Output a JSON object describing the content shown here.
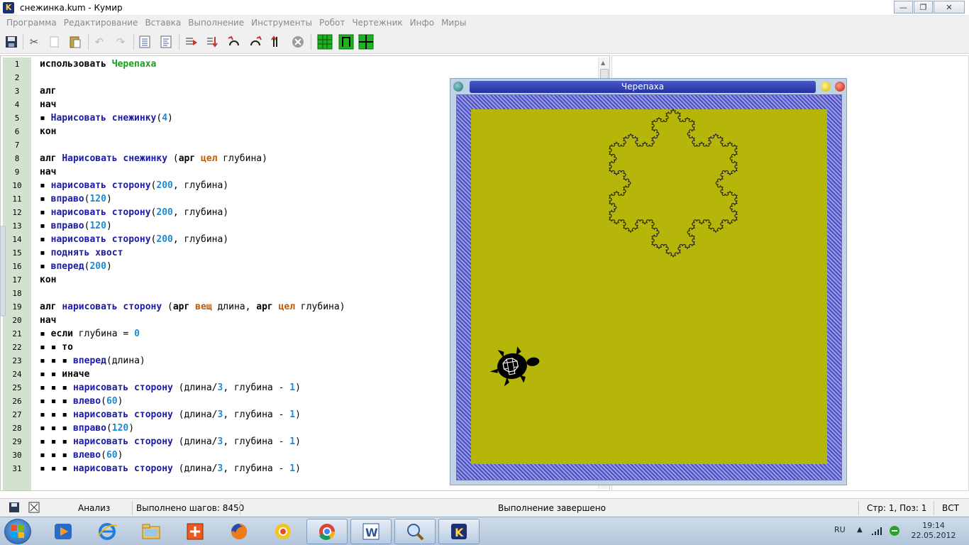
{
  "window": {
    "title": "снежинка.kum - Кумир",
    "app_icon_letter": "K",
    "buttons": [
      "minimize",
      "maximize",
      "close"
    ]
  },
  "menu": [
    "Программа",
    "Редактирование",
    "Вставка",
    "Выполнение",
    "Инструменты",
    "Робот",
    "Чертежник",
    "Инфо",
    "Миры"
  ],
  "toolbar": {
    "icons": [
      "save-icon",
      "cut-icon",
      "copy-icon",
      "paste-icon",
      "undo-icon",
      "redo-icon",
      "indent-icon",
      "unindent-icon",
      "run-icon",
      "step-icon",
      "step-into-icon",
      "step-out-icon",
      "to-end-icon",
      "stop-icon",
      "grid-icon",
      "robot-window-icon",
      "drawer-window-icon"
    ]
  },
  "editor": {
    "lines": [
      {
        "n": "1",
        "tokens": [
          [
            "k",
            "использовать "
          ],
          [
            "g",
            "Черепаха"
          ]
        ]
      },
      {
        "n": "2",
        "tokens": []
      },
      {
        "n": "3",
        "tokens": [
          [
            "k",
            "алг"
          ]
        ]
      },
      {
        "n": "4",
        "tokens": [
          [
            "k",
            "нач"
          ]
        ]
      },
      {
        "n": "5",
        "tokens": [
          [
            "k",
            "▪ "
          ],
          [
            "n",
            "Нарисовать снежинку"
          ],
          [
            "p",
            "("
          ],
          [
            "num",
            "4"
          ],
          [
            "p",
            ")"
          ]
        ]
      },
      {
        "n": "6",
        "tokens": [
          [
            "k",
            "кон"
          ]
        ]
      },
      {
        "n": "7",
        "tokens": []
      },
      {
        "n": "8",
        "tokens": [
          [
            "k",
            "алг "
          ],
          [
            "n",
            "Нарисовать снежинку"
          ],
          [
            "p",
            " ("
          ],
          [
            "k",
            "арг "
          ],
          [
            "t",
            "цел"
          ],
          [
            "p",
            " глубина)"
          ]
        ]
      },
      {
        "n": "9",
        "tokens": [
          [
            "k",
            "нач"
          ]
        ]
      },
      {
        "n": "10",
        "tokens": [
          [
            "k",
            "▪ "
          ],
          [
            "n",
            "нарисовать сторону"
          ],
          [
            "p",
            "("
          ],
          [
            "num",
            "200"
          ],
          [
            "p",
            ", глубина)"
          ]
        ]
      },
      {
        "n": "11",
        "tokens": [
          [
            "k",
            "▪ "
          ],
          [
            "n",
            "вправо"
          ],
          [
            "p",
            "("
          ],
          [
            "num",
            "120"
          ],
          [
            "p",
            ")"
          ]
        ]
      },
      {
        "n": "12",
        "tokens": [
          [
            "k",
            "▪ "
          ],
          [
            "n",
            "нарисовать сторону"
          ],
          [
            "p",
            "("
          ],
          [
            "num",
            "200"
          ],
          [
            "p",
            ", глубина)"
          ]
        ]
      },
      {
        "n": "13",
        "tokens": [
          [
            "k",
            "▪ "
          ],
          [
            "n",
            "вправо"
          ],
          [
            "p",
            "("
          ],
          [
            "num",
            "120"
          ],
          [
            "p",
            ")"
          ]
        ]
      },
      {
        "n": "14",
        "tokens": [
          [
            "k",
            "▪ "
          ],
          [
            "n",
            "нарисовать сторону"
          ],
          [
            "p",
            "("
          ],
          [
            "num",
            "200"
          ],
          [
            "p",
            ", глубина)"
          ]
        ]
      },
      {
        "n": "15",
        "tokens": [
          [
            "k",
            "▪ "
          ],
          [
            "n",
            "поднять хвост"
          ]
        ]
      },
      {
        "n": "16",
        "tokens": [
          [
            "k",
            "▪ "
          ],
          [
            "n",
            "вперед"
          ],
          [
            "p",
            "("
          ],
          [
            "num",
            "200"
          ],
          [
            "p",
            ")"
          ]
        ]
      },
      {
        "n": "17",
        "tokens": [
          [
            "k",
            "кон"
          ]
        ]
      },
      {
        "n": "18",
        "tokens": []
      },
      {
        "n": "19",
        "tokens": [
          [
            "k",
            "алг "
          ],
          [
            "n",
            "нарисовать сторону"
          ],
          [
            "p",
            " ("
          ],
          [
            "k",
            "арг "
          ],
          [
            "t",
            "вещ"
          ],
          [
            "p",
            " длина, "
          ],
          [
            "k",
            "арг "
          ],
          [
            "t",
            "цел"
          ],
          [
            "p",
            " глубина)"
          ]
        ]
      },
      {
        "n": "20",
        "tokens": [
          [
            "k",
            "нач"
          ]
        ]
      },
      {
        "n": "21",
        "tokens": [
          [
            "k",
            "▪ если"
          ],
          [
            "p",
            " глубина = "
          ],
          [
            "num",
            "0"
          ]
        ]
      },
      {
        "n": "22",
        "tokens": [
          [
            "k",
            "▪ ▪ то"
          ]
        ]
      },
      {
        "n": "23",
        "tokens": [
          [
            "k",
            "▪ ▪ ▪ "
          ],
          [
            "n",
            "вперед"
          ],
          [
            "p",
            "(длина)"
          ]
        ]
      },
      {
        "n": "24",
        "tokens": [
          [
            "k",
            "▪ ▪ иначе"
          ]
        ]
      },
      {
        "n": "25",
        "tokens": [
          [
            "k",
            "▪ ▪ ▪ "
          ],
          [
            "n",
            "нарисовать сторону"
          ],
          [
            "p",
            " (длина/"
          ],
          [
            "num",
            "3"
          ],
          [
            "p",
            ", глубина - "
          ],
          [
            "num",
            "1"
          ],
          [
            "p",
            ")"
          ]
        ]
      },
      {
        "n": "26",
        "tokens": [
          [
            "k",
            "▪ ▪ ▪ "
          ],
          [
            "n",
            "влево"
          ],
          [
            "p",
            "("
          ],
          [
            "num",
            "60"
          ],
          [
            "p",
            ")"
          ]
        ]
      },
      {
        "n": "27",
        "tokens": [
          [
            "k",
            "▪ ▪ ▪ "
          ],
          [
            "n",
            "нарисовать сторону"
          ],
          [
            "p",
            " (длина/"
          ],
          [
            "num",
            "3"
          ],
          [
            "p",
            ", глубина - "
          ],
          [
            "num",
            "1"
          ],
          [
            "p",
            ")"
          ]
        ]
      },
      {
        "n": "28",
        "tokens": [
          [
            "k",
            "▪ ▪ ▪ "
          ],
          [
            "n",
            "вправо"
          ],
          [
            "p",
            "("
          ],
          [
            "num",
            "120"
          ],
          [
            "p",
            ")"
          ]
        ]
      },
      {
        "n": "29",
        "tokens": [
          [
            "k",
            "▪ ▪ ▪ "
          ],
          [
            "n",
            "нарисовать сторону"
          ],
          [
            "p",
            " (длина/"
          ],
          [
            "num",
            "3"
          ],
          [
            "p",
            ", глубина - "
          ],
          [
            "num",
            "1"
          ],
          [
            "p",
            ")"
          ]
        ]
      },
      {
        "n": "30",
        "tokens": [
          [
            "k",
            "▪ ▪ ▪ "
          ],
          [
            "n",
            "влево"
          ],
          [
            "p",
            "("
          ],
          [
            "num",
            "60"
          ],
          [
            "p",
            ")"
          ]
        ]
      },
      {
        "n": "31",
        "tokens": [
          [
            "k",
            "▪ ▪ ▪ "
          ],
          [
            "n",
            "нарисовать сторону"
          ],
          [
            "p",
            " (длина/"
          ],
          [
            "num",
            "3"
          ],
          [
            "p",
            ", глубина - "
          ],
          [
            "num",
            "1"
          ],
          [
            "p",
            ")"
          ]
        ]
      }
    ]
  },
  "turtle_window": {
    "title": "Черепаха",
    "depth": 4,
    "colors": {
      "field": "#b5b50a",
      "border_pattern": "#4b4fc2",
      "line": "#1a1a1a",
      "turtle": "#000000"
    }
  },
  "status": {
    "analysis": "Анализ",
    "steps": "Выполнено шагов: 8450",
    "state": "Выполнение завершено",
    "position": "Стр: 1, Поз: 1",
    "mode": "ВСТ"
  },
  "taskbar": {
    "apps": [
      "media-player-icon",
      "ie-icon",
      "explorer-icon",
      "app-icon-orange",
      "firefox-icon",
      "chrome-yellow-icon",
      "chrome-icon",
      "word-icon",
      "search-tool-icon",
      "kumir-icon"
    ],
    "language": "RU",
    "time": "19:14",
    "date": "22.05.2012"
  }
}
